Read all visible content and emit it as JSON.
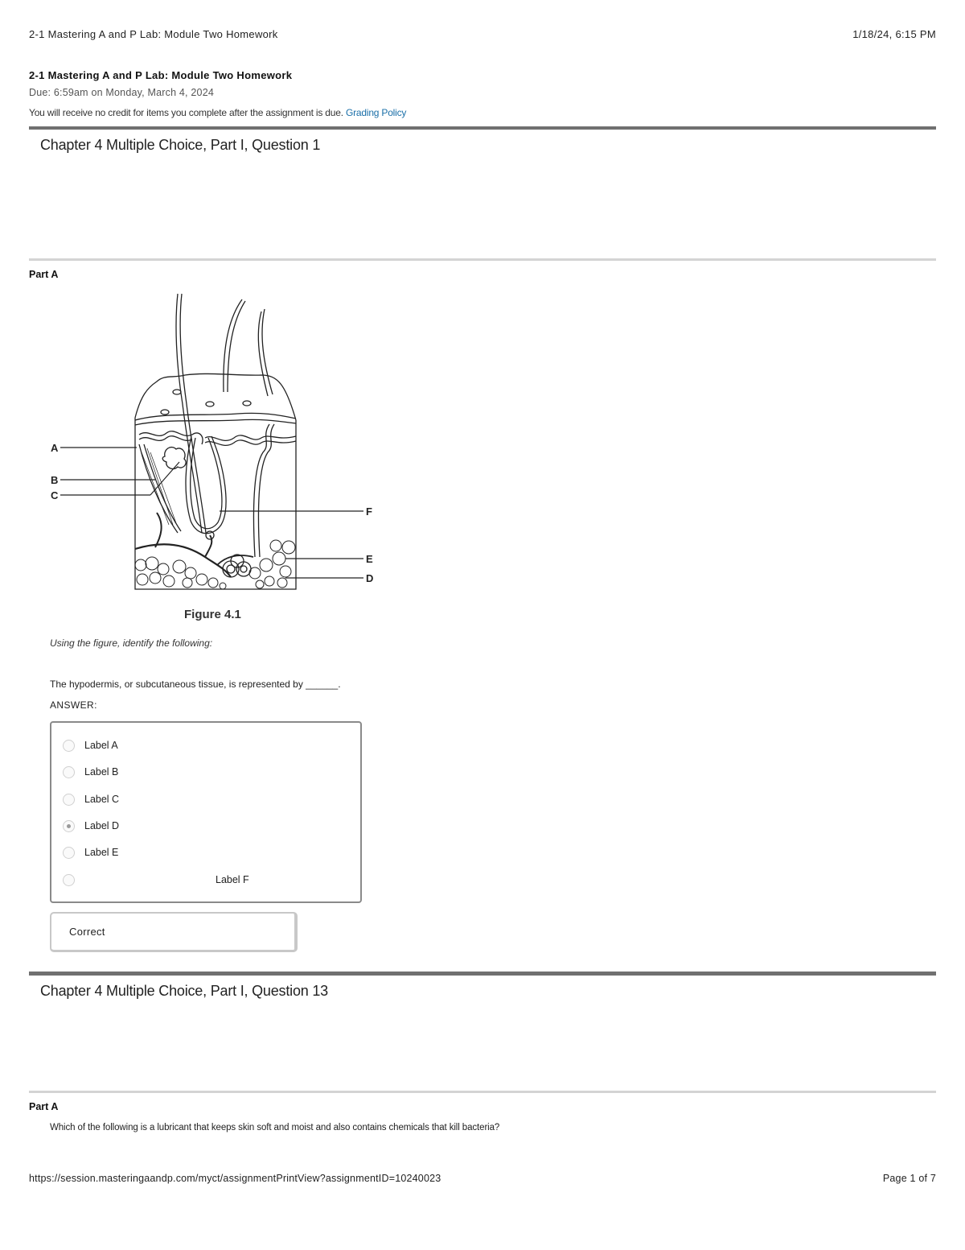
{
  "print_header": {
    "title": "2-1 Mastering A and P Lab: Module Two Homework",
    "datetime": "1/18/24, 6:15 PM"
  },
  "assignment": {
    "title": "2-1 Mastering A and P Lab: Module Two Homework",
    "due": "Due: 6:59am on Monday, March 4, 2024",
    "credit_notice": "You will receive no credit for items you complete after the assignment is due.",
    "grading_policy_link": "Grading Policy"
  },
  "questions": [
    {
      "title": "Chapter 4 Multiple Choice, Part I, Question 1",
      "part_label": "Part A",
      "figure": {
        "caption": "Figure 4.1",
        "labels": [
          "A",
          "B",
          "C",
          "D",
          "E",
          "F"
        ]
      },
      "instruction": "Using the figure, identify the following:",
      "prompt": "The hypodermis, or subcutaneous tissue, is represented by ______.",
      "answer_label": "ANSWER:",
      "options": [
        {
          "label": "Label A",
          "selected": false
        },
        {
          "label": "Label B",
          "selected": false
        },
        {
          "label": "Label C",
          "selected": false
        },
        {
          "label": "Label D",
          "selected": true
        },
        {
          "label": "Label E",
          "selected": false
        },
        {
          "label": "Label F",
          "selected": false
        }
      ],
      "feedback": "Correct"
    },
    {
      "title": "Chapter 4 Multiple Choice, Part I, Question 13",
      "part_label": "Part A",
      "prompt": "Which of the following is a lubricant that keeps skin soft and moist and also contains chemicals that kill bacteria?"
    }
  ],
  "print_footer": {
    "url": "https://session.masteringaandp.com/myct/assignmentPrintView?assignmentID=10240023",
    "page": "Page 1 of 7"
  }
}
